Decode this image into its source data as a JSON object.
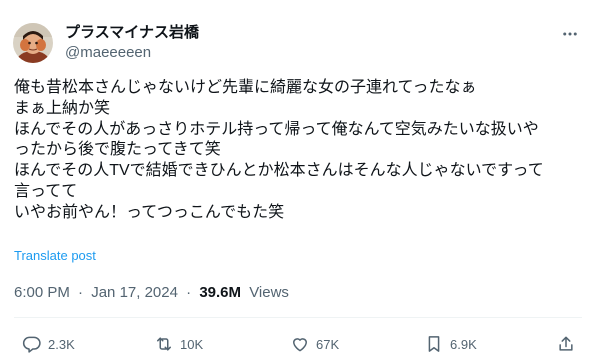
{
  "author": {
    "display_name": "プラスマイナス岩橋",
    "handle": "@maeeeeen",
    "avatar_icon": "profile-avatar"
  },
  "tweet": {
    "lines": [
      "俺も昔松本さんじゃないけど先輩に綺麗な女の子連れてったなぁ",
      "まぁ上納か笑",
      "ほんでその人があっさりホテル持って帰って俺なんて空気みたいな扱いや",
      "ったから後で腹たってきて笑",
      "ほんでその人TVで結婚できひんとか松本さんはそんな人じゃないですって",
      "言ってて",
      "いやお前やん！ってつっこんでもた笑"
    ],
    "translate_label": "Translate post"
  },
  "meta": {
    "time": "6:00 PM",
    "separator": "·",
    "date": "Jan 17, 2024",
    "views_count": "39.6M",
    "views_label": "Views"
  },
  "actions": {
    "replies": "2.3K",
    "reposts": "10K",
    "likes": "67K",
    "bookmarks": "6.9K"
  },
  "colors": {
    "text": "#0f1419",
    "secondary": "#536471",
    "link": "#1d9bf0",
    "divider": "#eff3f4"
  }
}
